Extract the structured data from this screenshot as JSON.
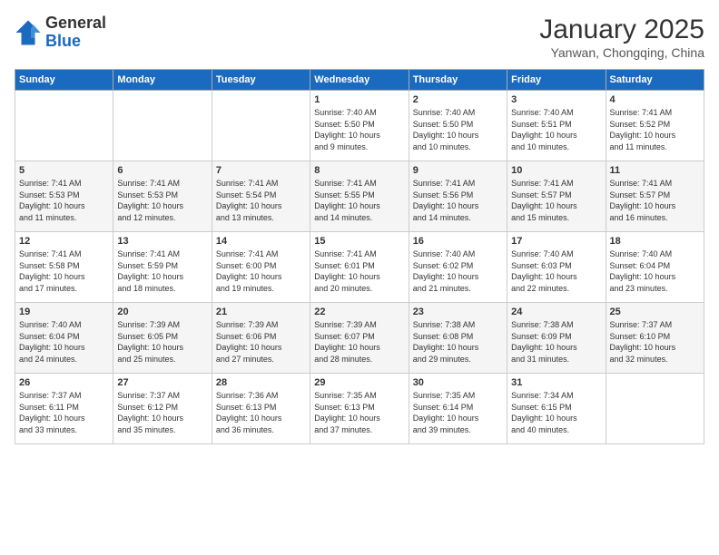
{
  "header": {
    "logo": {
      "general": "General",
      "blue": "Blue"
    },
    "title": "January 2025",
    "subtitle": "Yanwan, Chongqing, China"
  },
  "weekdays": [
    "Sunday",
    "Monday",
    "Tuesday",
    "Wednesday",
    "Thursday",
    "Friday",
    "Saturday"
  ],
  "weeks": [
    [
      {
        "day": "",
        "info": ""
      },
      {
        "day": "",
        "info": ""
      },
      {
        "day": "",
        "info": ""
      },
      {
        "day": "1",
        "info": "Sunrise: 7:40 AM\nSunset: 5:50 PM\nDaylight: 10 hours\nand 9 minutes."
      },
      {
        "day": "2",
        "info": "Sunrise: 7:40 AM\nSunset: 5:50 PM\nDaylight: 10 hours\nand 10 minutes."
      },
      {
        "day": "3",
        "info": "Sunrise: 7:40 AM\nSunset: 5:51 PM\nDaylight: 10 hours\nand 10 minutes."
      },
      {
        "day": "4",
        "info": "Sunrise: 7:41 AM\nSunset: 5:52 PM\nDaylight: 10 hours\nand 11 minutes."
      }
    ],
    [
      {
        "day": "5",
        "info": "Sunrise: 7:41 AM\nSunset: 5:53 PM\nDaylight: 10 hours\nand 11 minutes."
      },
      {
        "day": "6",
        "info": "Sunrise: 7:41 AM\nSunset: 5:53 PM\nDaylight: 10 hours\nand 12 minutes."
      },
      {
        "day": "7",
        "info": "Sunrise: 7:41 AM\nSunset: 5:54 PM\nDaylight: 10 hours\nand 13 minutes."
      },
      {
        "day": "8",
        "info": "Sunrise: 7:41 AM\nSunset: 5:55 PM\nDaylight: 10 hours\nand 14 minutes."
      },
      {
        "day": "9",
        "info": "Sunrise: 7:41 AM\nSunset: 5:56 PM\nDaylight: 10 hours\nand 14 minutes."
      },
      {
        "day": "10",
        "info": "Sunrise: 7:41 AM\nSunset: 5:57 PM\nDaylight: 10 hours\nand 15 minutes."
      },
      {
        "day": "11",
        "info": "Sunrise: 7:41 AM\nSunset: 5:57 PM\nDaylight: 10 hours\nand 16 minutes."
      }
    ],
    [
      {
        "day": "12",
        "info": "Sunrise: 7:41 AM\nSunset: 5:58 PM\nDaylight: 10 hours\nand 17 minutes."
      },
      {
        "day": "13",
        "info": "Sunrise: 7:41 AM\nSunset: 5:59 PM\nDaylight: 10 hours\nand 18 minutes."
      },
      {
        "day": "14",
        "info": "Sunrise: 7:41 AM\nSunset: 6:00 PM\nDaylight: 10 hours\nand 19 minutes."
      },
      {
        "day": "15",
        "info": "Sunrise: 7:41 AM\nSunset: 6:01 PM\nDaylight: 10 hours\nand 20 minutes."
      },
      {
        "day": "16",
        "info": "Sunrise: 7:40 AM\nSunset: 6:02 PM\nDaylight: 10 hours\nand 21 minutes."
      },
      {
        "day": "17",
        "info": "Sunrise: 7:40 AM\nSunset: 6:03 PM\nDaylight: 10 hours\nand 22 minutes."
      },
      {
        "day": "18",
        "info": "Sunrise: 7:40 AM\nSunset: 6:04 PM\nDaylight: 10 hours\nand 23 minutes."
      }
    ],
    [
      {
        "day": "19",
        "info": "Sunrise: 7:40 AM\nSunset: 6:04 PM\nDaylight: 10 hours\nand 24 minutes."
      },
      {
        "day": "20",
        "info": "Sunrise: 7:39 AM\nSunset: 6:05 PM\nDaylight: 10 hours\nand 25 minutes."
      },
      {
        "day": "21",
        "info": "Sunrise: 7:39 AM\nSunset: 6:06 PM\nDaylight: 10 hours\nand 27 minutes."
      },
      {
        "day": "22",
        "info": "Sunrise: 7:39 AM\nSunset: 6:07 PM\nDaylight: 10 hours\nand 28 minutes."
      },
      {
        "day": "23",
        "info": "Sunrise: 7:38 AM\nSunset: 6:08 PM\nDaylight: 10 hours\nand 29 minutes."
      },
      {
        "day": "24",
        "info": "Sunrise: 7:38 AM\nSunset: 6:09 PM\nDaylight: 10 hours\nand 31 minutes."
      },
      {
        "day": "25",
        "info": "Sunrise: 7:37 AM\nSunset: 6:10 PM\nDaylight: 10 hours\nand 32 minutes."
      }
    ],
    [
      {
        "day": "26",
        "info": "Sunrise: 7:37 AM\nSunset: 6:11 PM\nDaylight: 10 hours\nand 33 minutes."
      },
      {
        "day": "27",
        "info": "Sunrise: 7:37 AM\nSunset: 6:12 PM\nDaylight: 10 hours\nand 35 minutes."
      },
      {
        "day": "28",
        "info": "Sunrise: 7:36 AM\nSunset: 6:13 PM\nDaylight: 10 hours\nand 36 minutes."
      },
      {
        "day": "29",
        "info": "Sunrise: 7:35 AM\nSunset: 6:13 PM\nDaylight: 10 hours\nand 37 minutes."
      },
      {
        "day": "30",
        "info": "Sunrise: 7:35 AM\nSunset: 6:14 PM\nDaylight: 10 hours\nand 39 minutes."
      },
      {
        "day": "31",
        "info": "Sunrise: 7:34 AM\nSunset: 6:15 PM\nDaylight: 10 hours\nand 40 minutes."
      },
      {
        "day": "",
        "info": ""
      }
    ]
  ]
}
